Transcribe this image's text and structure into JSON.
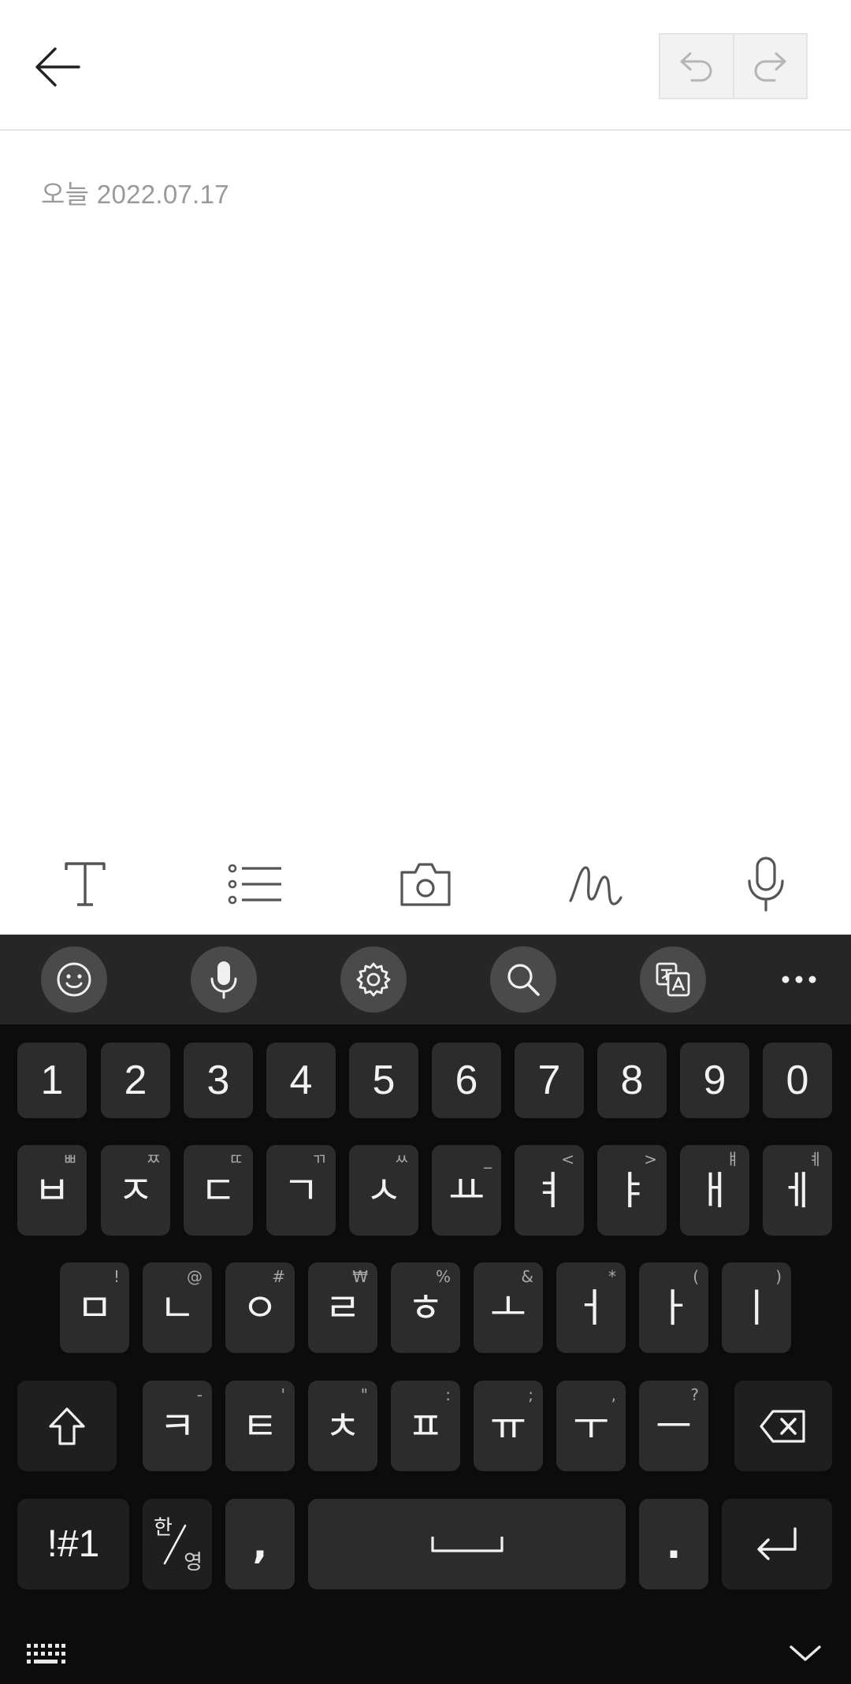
{
  "header": {
    "back_icon": "arrow-left-icon",
    "undo_icon": "undo-icon",
    "redo_icon": "redo-icon"
  },
  "note": {
    "date_text": "오늘 2022.07.17"
  },
  "edit_toolbar": {
    "tools": [
      "text-format-icon",
      "list-icon",
      "camera-icon",
      "handwriting-icon",
      "voice-recording-icon"
    ]
  },
  "keyboard_toolbar": {
    "tools": [
      "emoji-icon",
      "voice-input-icon",
      "settings-icon",
      "search-icon",
      "translate-icon",
      "more-icon"
    ]
  },
  "keyboard": {
    "number_row": [
      "1",
      "2",
      "3",
      "4",
      "5",
      "6",
      "7",
      "8",
      "9",
      "0"
    ],
    "row1": [
      {
        "main": "ㅂ",
        "hint": "ㅃ"
      },
      {
        "main": "ㅈ",
        "hint": "ㅉ"
      },
      {
        "main": "ㄷ",
        "hint": "ㄸ"
      },
      {
        "main": "ㄱ",
        "hint": "ㄲ"
      },
      {
        "main": "ㅅ",
        "hint": "ㅆ"
      },
      {
        "main": "ㅛ",
        "hint": "_"
      },
      {
        "main": "ㅕ",
        "hint": "<"
      },
      {
        "main": "ㅑ",
        "hint": ">"
      },
      {
        "main": "ㅐ",
        "hint": "ㅒ"
      },
      {
        "main": "ㅔ",
        "hint": "ㅖ"
      }
    ],
    "row2": [
      {
        "main": "ㅁ",
        "hint": "!"
      },
      {
        "main": "ㄴ",
        "hint": "@"
      },
      {
        "main": "ㅇ",
        "hint": "#"
      },
      {
        "main": "ㄹ",
        "hint": "₩"
      },
      {
        "main": "ㅎ",
        "hint": "%"
      },
      {
        "main": "ㅗ",
        "hint": "&"
      },
      {
        "main": "ㅓ",
        "hint": "*"
      },
      {
        "main": "ㅏ",
        "hint": "("
      },
      {
        "main": "ㅣ",
        "hint": ")"
      }
    ],
    "row3": [
      {
        "main": "ㅋ",
        "hint": "-"
      },
      {
        "main": "ㅌ",
        "hint": "'"
      },
      {
        "main": "ㅊ",
        "hint": "\""
      },
      {
        "main": "ㅍ",
        "hint": ":"
      },
      {
        "main": "ㅠ",
        "hint": ";"
      },
      {
        "main": "ㅜ",
        "hint": ","
      },
      {
        "main": "ㅡ",
        "hint": "?"
      }
    ],
    "shift_icon": "shift-icon",
    "backspace_icon": "backspace-icon",
    "symbols_label": "!#1",
    "lang_top": "한",
    "lang_bottom": "영",
    "comma_label": ",",
    "space_icon": "space-icon",
    "period_label": ".",
    "enter_icon": "enter-icon",
    "keyboard_switch_icon": "keyboard-icon",
    "hide_keyboard_icon": "chevron-down-icon"
  }
}
